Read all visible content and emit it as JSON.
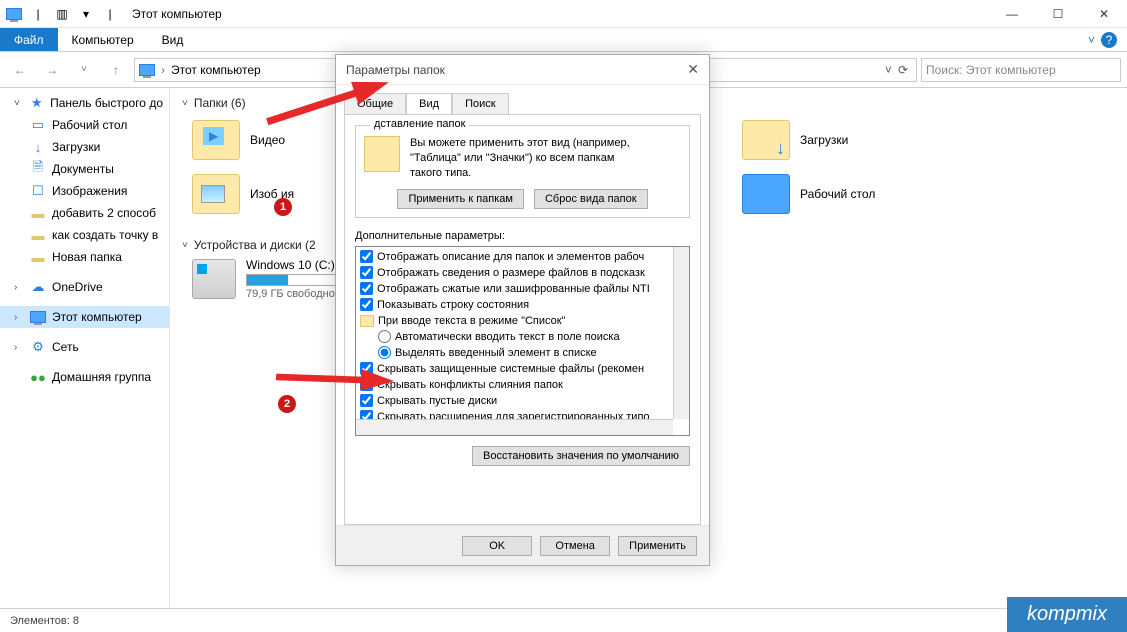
{
  "window": {
    "title": "Этот компьютер",
    "minimize": "—",
    "maximize": "☐",
    "close": "✕"
  },
  "ribbon": {
    "file": "Файл",
    "computer": "Компьютер",
    "view": "Вид",
    "chevron": "˅",
    "help": "?"
  },
  "address": {
    "back": "←",
    "forward": "→",
    "up": "↑",
    "path": "Этот компьютер",
    "dropdown": "˅",
    "refresh": "⟳",
    "search_placeholder": "Поиск: Этот компьютер"
  },
  "sidebar": {
    "quick_access": "Панель быстрого до",
    "desktop": "Рабочий стол",
    "downloads": "Загрузки",
    "documents": "Документы",
    "pictures": "Изображения",
    "add2ways": "добавить 2 способ",
    "restore_point": "как создать точку в",
    "new_folder": "Новая папка",
    "onedrive": "OneDrive",
    "this_pc": "Этот компьютер",
    "network": "Сеть",
    "homegroup": "Домашняя группа"
  },
  "content": {
    "folders_header": "Папки (6)",
    "devices_header": "Устройства и диски (2",
    "video": "Видео",
    "pictures": "Изоб          ия",
    "downloads": "Загрузки",
    "desktop": "Рабочий стол",
    "drive_c": "Windows 10 (C:)",
    "drive_c_free": "79,9 ГБ свободно ",
    "drive_c_fill_pct": 32
  },
  "dialog": {
    "title": "Параметры папок",
    "close": "✕",
    "tab_general": "Общие",
    "tab_view": "Вид",
    "tab_search": "Поиск",
    "folder_view_title": "дставление папок",
    "folder_view_desc1": "Вы можете применить этот вид (например,",
    "folder_view_desc2": "\"Таблица\" или \"Значки\") ко всем папкам",
    "folder_view_desc3": "такого типа.",
    "apply_to_folders": "Применить к папкам",
    "reset_folders": "Сброс вида папок",
    "extra_params": "Дополнительные параметры:",
    "params": {
      "p1": "Отображать описание для папок и элементов рабоч",
      "p2": "Отображать сведения о размере файлов в подсказк",
      "p3": "Отображать сжатые или зашифрованные файлы NTI",
      "p4": "Показывать строку состояния",
      "p5": "При вводе текста в режиме \"Список\"",
      "p6": "Автоматически вводить текст в поле поиска",
      "p7": "Выделять введенный элемент в списке",
      "p8": "Скрывать защищенные системные файлы (рекомен",
      "p9": "Скрывать конфликты слияния папок",
      "p10": "Скрывать пустые диски",
      "p11": "Скрывать расширения для зарегистрированных типо"
    },
    "restore_defaults": "Восстановить значения по умолчанию",
    "ok": "OK",
    "cancel": "Отмена",
    "apply": "Применить"
  },
  "status": {
    "elements": "Элементов: 8"
  },
  "annotation": {
    "b1": "1",
    "b2": "2"
  },
  "watermark": "kompmix"
}
